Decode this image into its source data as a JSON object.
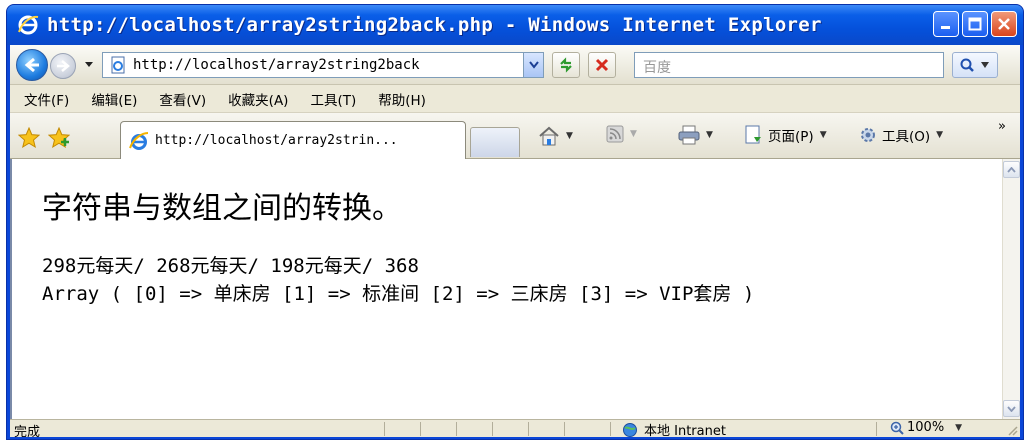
{
  "window": {
    "title": "http://localhost/array2string2back.php - Windows Internet Explorer"
  },
  "address_bar": {
    "url": "http://localhost/array2string2back",
    "search_placeholder": "百度"
  },
  "menu": {
    "items": [
      "文件(F)",
      "编辑(E)",
      "查看(V)",
      "收藏夹(A)",
      "工具(T)",
      "帮助(H)"
    ]
  },
  "tab": {
    "label": "http://localhost/array2strin..."
  },
  "command_bar": {
    "page_label": "页面(P)",
    "tools_label": "工具(O)",
    "more": "»"
  },
  "content": {
    "heading": "字符串与数组之间的转换。",
    "line1": "298元每天/ 268元每天/ 198元每天/ 368",
    "line2": "Array ( [0] => 单床房 [1] => 标准间 [2] => 三床房 [3] => VIP套房 )"
  },
  "status_bar": {
    "status": "完成",
    "zone": "本地 Intranet",
    "zoom": "100%"
  },
  "icons": [
    "ie-logo-icon",
    "back-arrow-icon",
    "forward-arrow-icon",
    "page-icon",
    "refresh-icon",
    "stop-icon",
    "search-icon",
    "favorites-star-icon",
    "add-favorites-icon",
    "home-icon",
    "feeds-icon",
    "print-icon",
    "tools-gear-icon",
    "intranet-globe-icon",
    "zoom-icon"
  ],
  "colors": {
    "titlebar": "#0a5fe8",
    "chrome": "#ece9d8",
    "close_button": "#d9441c"
  }
}
